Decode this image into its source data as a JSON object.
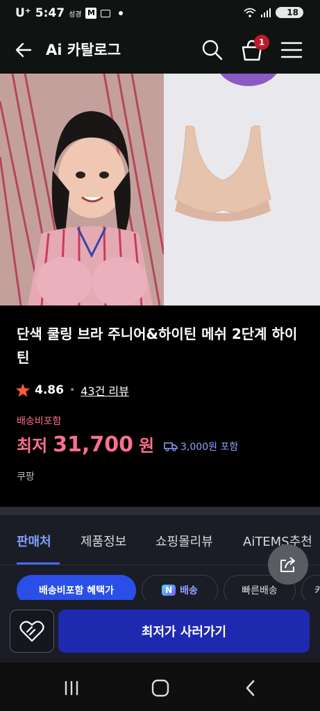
{
  "status_bar": {
    "carrier": "U⁺",
    "time": "5:47",
    "label_small": "성경",
    "mail_badge": "M",
    "battery": "18"
  },
  "header": {
    "title": "Ai 카탈로그",
    "cart_count": "1"
  },
  "product": {
    "title": "단색 쿨링 브라 주니어&하이틴 메쉬 2단계 하이틴",
    "rating": "4.86",
    "review_link": "43건 리뷰",
    "shipping_badge": "배송비포함",
    "price_prefix": "최저",
    "price": "31,700",
    "price_unit": "원",
    "delivery_note": "3,000원 포함",
    "seller": "쿠팡"
  },
  "tabs": [
    "판매처",
    "제품정보",
    "쇼핑몰리뷰",
    "AiTEMS추천"
  ],
  "chips": {
    "primary": "배송비포함 혜택가",
    "n_badge": "N",
    "n_label": "배송",
    "fast": "빠른배송",
    "more": "카"
  },
  "bottom": {
    "buy_label": "최저가 사러가기"
  },
  "colors": {
    "accent": "#2a4fe8",
    "price": "#ff6f8e",
    "buy_button": "#1d2ab0"
  }
}
